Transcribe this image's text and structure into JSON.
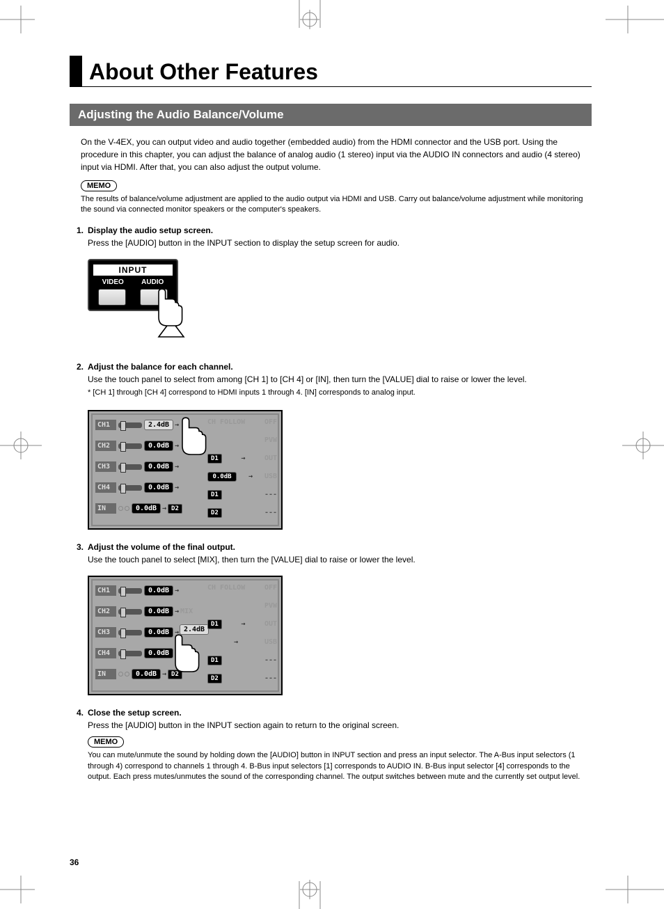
{
  "title": "About Other Features",
  "section_header": "Adjusting the Audio Balance/Volume",
  "intro": "On the V-4EX, you can output video and audio together (embedded audio) from the HDMI connector and the USB port. Using the procedure in this chapter, you can adjust the balance of analog audio (1 stereo) input via the AUDIO IN connectors and audio (4 stereo) input via HDMI. After that, you can also adjust the output volume.",
  "memo_label": "MEMO",
  "memo1": "The results of balance/volume adjustment are applied to the audio output via HDMI and USB. Carry out balance/volume adjustment while monitoring the sound via connected monitor speakers or the computer's speakers.",
  "steps": [
    {
      "num": "1.",
      "title": "Display the audio setup screen.",
      "desc": "Press the [AUDIO] button in the INPUT section to display the setup screen for audio."
    },
    {
      "num": "2.",
      "title": "Adjust the balance for each channel.",
      "desc": "Use the touch panel to select from among [CH 1] to [CH 4] or [IN], then turn the [VALUE] dial to raise or lower the level.",
      "note": "*   [CH 1] through [CH 4] correspond to HDMI inputs 1 through 4. [IN] corresponds to analog input."
    },
    {
      "num": "3.",
      "title": "Adjust the volume of the final output.",
      "desc": "Use the touch panel to select [MIX], then turn the [VALUE] dial to raise or lower the level."
    },
    {
      "num": "4.",
      "title": "Close the setup screen.",
      "desc": "Press the [AUDIO] button in the INPUT section again to return to the original screen."
    }
  ],
  "memo2": "You can mute/unmute the sound by holding down the [AUDIO] button in INPUT section and press an input selector. The A-Bus input selectors (1 through 4) correspond to channels 1 through 4. B-Bus input selectors [1] corresponds to AUDIO IN. B-Bus input selector [4] corresponds to the output. Each press mutes/unmutes the sound of the corresponding channel. The output switches between mute and the currently set output level.",
  "input_panel": {
    "label": "INPUT",
    "left": "VIDEO",
    "right": "AUDIO"
  },
  "lcd1": {
    "channels": [
      "CH1",
      "CH2",
      "CH3",
      "CH4",
      "IN"
    ],
    "values": [
      "2.4dB",
      "0.0dB",
      "0.0dB",
      "0.0dB",
      "0.0dB"
    ],
    "ch_follow": "CH FOLLOW",
    "off": "OFF",
    "pvw": "PVW",
    "out": "OUT",
    "usb": "USB",
    "d1": "D1",
    "d2": "D2",
    "mix_val": "0.0dB",
    "dashes": "---"
  },
  "lcd2": {
    "channels": [
      "CH1",
      "CH2",
      "CH3",
      "CH4",
      "IN"
    ],
    "values": [
      "0.0dB",
      "0.0dB",
      "0.0dB",
      "0.0dB",
      "0.0dB"
    ],
    "mix": "MIX",
    "mix_val": "2.4dB",
    "ch_follow": "CH FOLLOW",
    "off": "OFF",
    "pvw": "PVW",
    "out": "OUT",
    "usb": "USB",
    "d1": "D1",
    "d2": "D2",
    "dashes": "---"
  },
  "page_number": "36"
}
